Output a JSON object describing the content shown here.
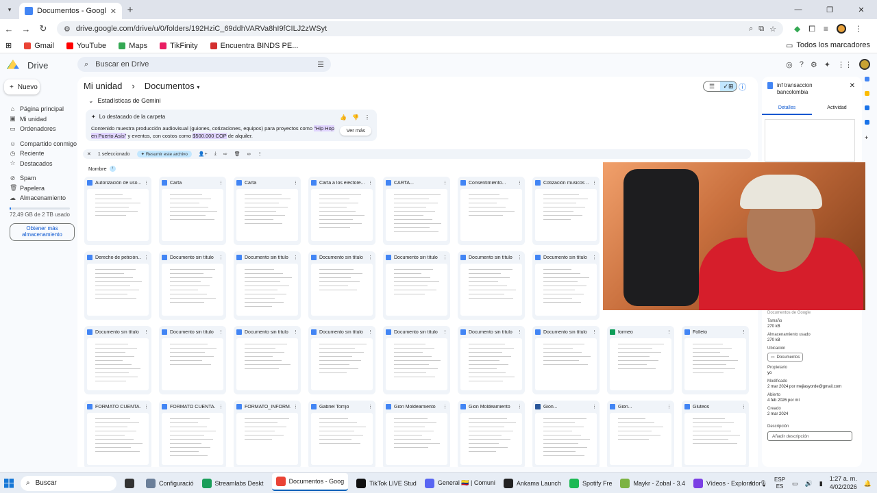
{
  "browser": {
    "tab_title": "Documentos - Google Drive",
    "url": "drive.google.com/drive/u/0/folders/192HziC_69ddhVARVa8hI9fCILJ2zWSyt",
    "bookmarks": [
      {
        "label": "Gmail",
        "color": "#ea4335"
      },
      {
        "label": "YouTube",
        "color": "#ff0000"
      },
      {
        "label": "Maps",
        "color": "#34a853"
      },
      {
        "label": "TikFinity",
        "color": "#e91e63"
      },
      {
        "label": "Encuentra BINDS PE...",
        "color": "#d32f2f"
      }
    ],
    "all_bookmarks": "Todos los marcadores"
  },
  "drive": {
    "app_name": "Drive",
    "search_placeholder": "Buscar en Drive",
    "new_button": "Nuevo",
    "nav": [
      {
        "label": "Página principal",
        "icon": "home-icon"
      },
      {
        "label": "Mi unidad",
        "icon": "drive-icon"
      },
      {
        "label": "Ordenadores",
        "icon": "computer-icon"
      },
      {
        "label": "Compartido conmigo",
        "icon": "people-icon"
      },
      {
        "label": "Reciente",
        "icon": "clock-icon"
      },
      {
        "label": "Destacados",
        "icon": "star-icon"
      },
      {
        "label": "Spam",
        "icon": "spam-icon"
      },
      {
        "label": "Papelera",
        "icon": "trash-icon"
      },
      {
        "label": "Almacenamiento",
        "icon": "cloud-icon"
      }
    ],
    "storage_text": "72,49 GB de 2 TB usado",
    "storage_button": "Obtener más almacenamiento",
    "breadcrumb_root": "Mi unidad",
    "breadcrumb_current": "Documentos",
    "gemini": {
      "header": "Estadísticas de Gemini",
      "card_title": "Lo destacado de la carpeta",
      "body_before": "Contenido muestra producción audiovisual (guiones, cotizaciones, equipos) para proyectos como ",
      "highlight1": "\"Hip Hop en Puerto Asís\"",
      "body_mid": " y eventos, con costos como ",
      "highlight2": "$500.000 COP",
      "body_after": " de alquiler.",
      "more_button": "Ver más"
    },
    "selection": {
      "count": "1 seleccionado",
      "summarize": "Resumir este archivo"
    },
    "sort_label": "Nombre",
    "files": [
      {
        "name": "Autorización de uso...",
        "type": "doc"
      },
      {
        "name": "Carta",
        "type": "doc"
      },
      {
        "name": "Carta",
        "type": "doc"
      },
      {
        "name": "Carta a los electore...",
        "type": "doc"
      },
      {
        "name": "CARTA...",
        "type": "doc"
      },
      {
        "name": "Consentimiento...",
        "type": "doc"
      },
      {
        "name": "Cotización musicos ...",
        "type": "doc"
      },
      {
        "name": "Derecho de petición...",
        "type": "doc"
      },
      {
        "name": "Documento sin título",
        "type": "doc"
      },
      {
        "name": "Documento sin título",
        "type": "doc"
      },
      {
        "name": "Documento sin título",
        "type": "doc"
      },
      {
        "name": "Documento sin título",
        "type": "doc"
      },
      {
        "name": "Documento sin título",
        "type": "doc"
      },
      {
        "name": "Documento sin título",
        "type": "doc"
      },
      {
        "name": "Documento sin título",
        "type": "doc"
      },
      {
        "name": "Documento sin título",
        "type": "doc"
      },
      {
        "name": "Documento sin título",
        "type": "doc"
      },
      {
        "name": "Documento sin título",
        "type": "doc"
      },
      {
        "name": "Documento sin título",
        "type": "doc"
      },
      {
        "name": "Documento sin título",
        "type": "doc"
      },
      {
        "name": "Documento sin título",
        "type": "doc"
      },
      {
        "name": "formeo",
        "type": "sheet"
      },
      {
        "name": "Folleto",
        "type": "doc"
      },
      {
        "name": "FORMATO CUENTA...",
        "type": "doc"
      },
      {
        "name": "FORMATO CUENTA...",
        "type": "doc"
      },
      {
        "name": "FORMATO_INFORM...",
        "type": "doc"
      },
      {
        "name": "Gabriel Torrijo",
        "type": "doc"
      },
      {
        "name": "Gion Moldeamiento",
        "type": "doc"
      },
      {
        "name": "Gion Moldeamiento",
        "type": "doc"
      },
      {
        "name": "Gion...",
        "type": "word"
      },
      {
        "name": "Gion...",
        "type": "doc"
      },
      {
        "name": "Gluteos",
        "type": "doc"
      }
    ]
  },
  "details": {
    "title": "inf transaccion bancolombia",
    "tab_details": "Detalles",
    "tab_activity": "Actividad",
    "type_value": "Documentos de Google",
    "props": [
      {
        "label": "Tamaño",
        "value": "270 kB"
      },
      {
        "label": "Almacenamiento usado",
        "value": "270 kB"
      },
      {
        "label": "Ubicación",
        "value": ""
      },
      {
        "label": "Propietario",
        "value": "yo"
      },
      {
        "label": "Modificado",
        "value": "2 mar 2024 por mejiasyorde@gmail.com"
      },
      {
        "label": "Abierto",
        "value": "4 feb 2026 por mí"
      },
      {
        "label": "Creado",
        "value": "2 mar 2024"
      },
      {
        "label": "Descripción",
        "value": ""
      }
    ],
    "location_chip": "Documentos",
    "description_placeholder": "Añadir descripción"
  },
  "taskbar": {
    "search": "Buscar",
    "apps": [
      {
        "label": "",
        "color": "#333"
      },
      {
        "label": "Configuració",
        "color": "#6b7f99"
      },
      {
        "label": "Streamlabs Deskt",
        "color": "#1b9e5a"
      },
      {
        "label": "Documentos - Goog",
        "color": "#ea4335",
        "active": true
      },
      {
        "label": "TikTok LIVE Stud",
        "color": "#111"
      },
      {
        "label": "General 🇨🇴 | Comuni",
        "color": "#5865f2"
      },
      {
        "label": "Ankama Launch",
        "color": "#222"
      },
      {
        "label": "Spotify Fre",
        "color": "#1db954"
      },
      {
        "label": "Maykr - Zobal - 3.4",
        "color": "#7cb342"
      },
      {
        "label": "Vídeos - Explorador",
        "color": "#7b3fe4"
      }
    ],
    "lang_top": "ESP",
    "lang_bottom": "ES",
    "time": "1:27 a. m.",
    "date": "4/02/2026"
  }
}
